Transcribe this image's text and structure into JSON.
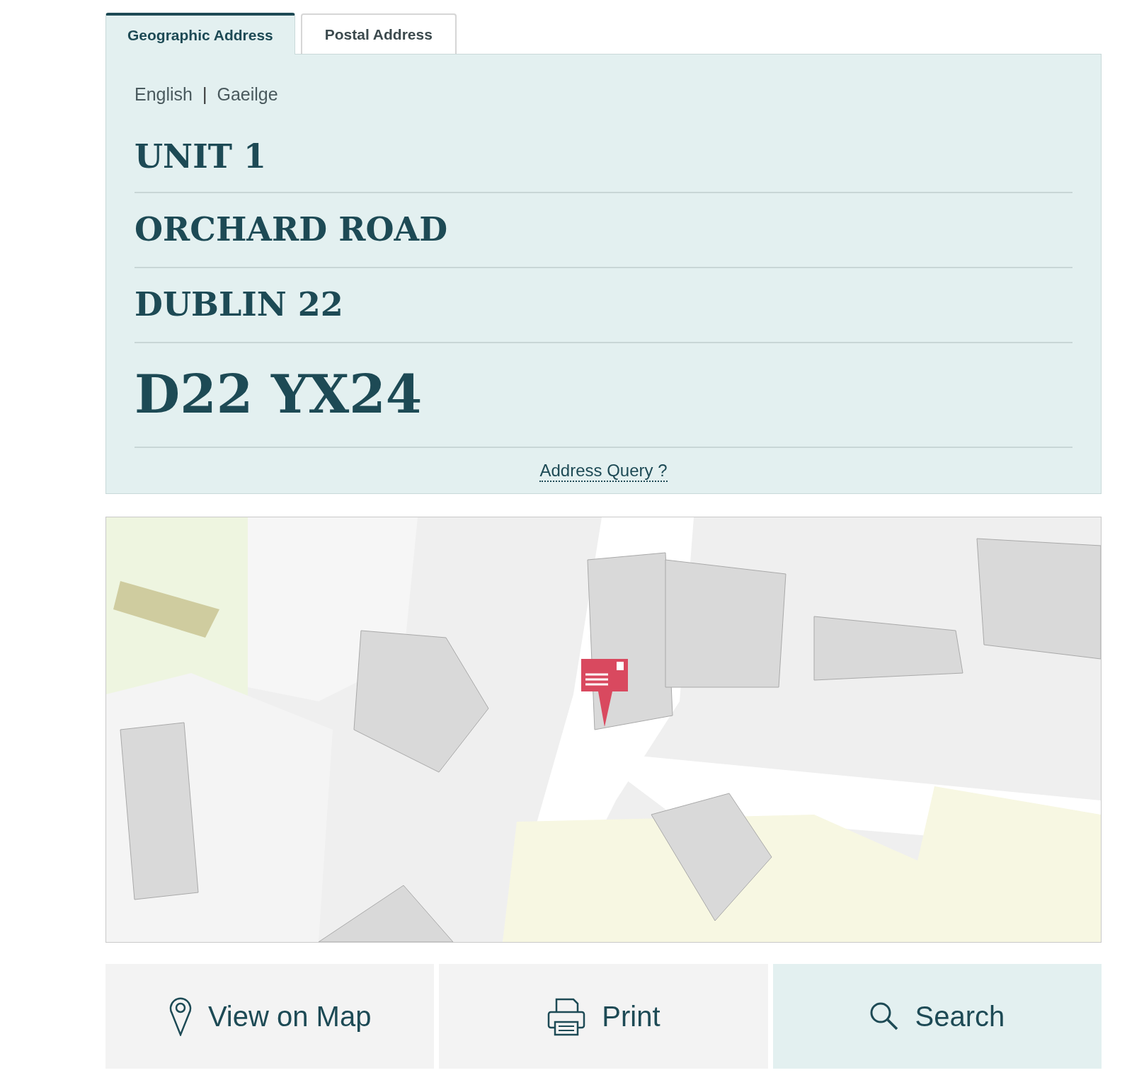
{
  "tabs": [
    {
      "label": "Geographic Address",
      "selected": true
    },
    {
      "label": "Postal Address",
      "selected": false
    }
  ],
  "languages": [
    "English",
    "Gaeilge"
  ],
  "language_separator": "|",
  "address_lines": [
    "UNIT 1",
    "ORCHARD ROAD",
    "DUBLIN 22"
  ],
  "eircode": "D22 YX24",
  "query_link": "Address Query ?",
  "map": {
    "kind": "picture"
  },
  "actions": [
    {
      "label": "View on Map",
      "kind": "pin",
      "selected": false
    },
    {
      "label": "Print",
      "kind": "print",
      "selected": false
    },
    {
      "label": "Search",
      "kind": "search",
      "selected": true
    }
  ]
}
